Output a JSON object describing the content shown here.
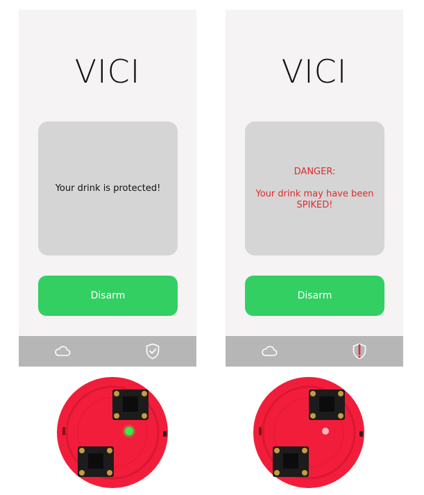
{
  "screens": [
    {
      "title": "VICI",
      "status_lines": [
        "Your drink is protected!"
      ],
      "status_color": "#111111",
      "button_label": "Disarm",
      "nav": [
        {
          "icon": "cloud-icon"
        },
        {
          "icon": "shield-check-icon"
        }
      ]
    },
    {
      "title": "VICI",
      "status_lines": [
        "DANGER:",
        "Your drink may have been SPIKED!"
      ],
      "status_color": "#e02a2a",
      "button_label": "Disarm",
      "nav": [
        {
          "icon": "cloud-icon"
        },
        {
          "icon": "shield-alert-icon"
        }
      ]
    }
  ],
  "devices": [
    {
      "led": "green"
    },
    {
      "led": "off"
    }
  ],
  "colors": {
    "screen_bg": "#f5f3f4",
    "card_bg": "#d5d5d5",
    "button_green": "#33cf62",
    "nav_bar": "#b6b6b6",
    "danger_red": "#e02a2a",
    "device_red": "#f21d3b",
    "led_green": "#3ee84a"
  }
}
